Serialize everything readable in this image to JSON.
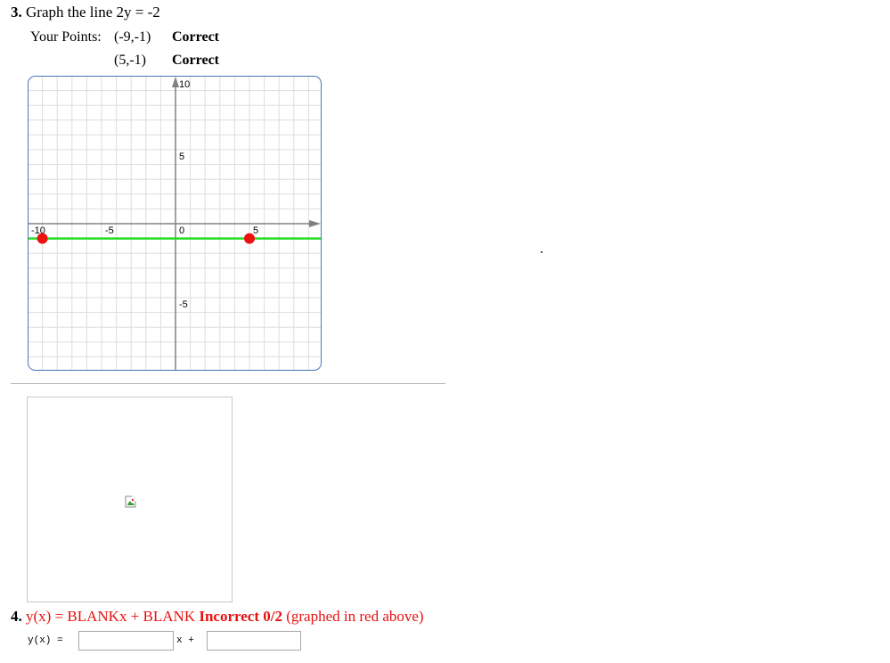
{
  "question3": {
    "number": "3",
    "prompt": "Graph the line 2y = -2",
    "points_label": "Your Points:",
    "points": [
      {
        "text": "(-9,-1)",
        "status": "Correct"
      },
      {
        "text": "(5,-1)",
        "status": "Correct"
      }
    ],
    "graph": {
      "x_tick_labels": [
        "-10",
        "-5",
        "0",
        "5"
      ],
      "y_tick_labels": [
        "10",
        "5",
        "-5"
      ],
      "x_range": [
        -10,
        10
      ],
      "y_range": [
        -10,
        10
      ],
      "line_y": -1,
      "plotted_points": [
        {
          "x": -9,
          "y": -1
        },
        {
          "x": 5,
          "y": -1
        }
      ],
      "colors": {
        "line": "#22dd22",
        "point": "#ee1111",
        "grid": "#dddddd",
        "border": "#4a74b8",
        "axis": "#808080"
      }
    }
  },
  "question4": {
    "number": "4",
    "text": "y(x) = BLANKx + BLANK",
    "result": "Incorrect 0/2",
    "note": "(graphed in red above)",
    "input_prefix": "y(x) =",
    "input_mid": "x +",
    "slope_value": "",
    "intercept_value": ""
  }
}
